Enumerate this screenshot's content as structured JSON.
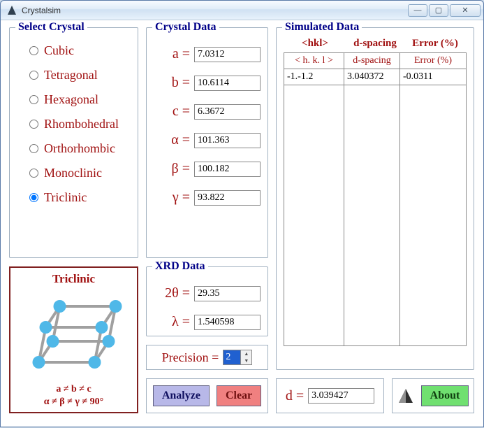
{
  "window": {
    "title": "Crystalsim"
  },
  "select_crystal": {
    "legend": "Select Crystal",
    "options": [
      "Cubic",
      "Tetragonal",
      "Hexagonal",
      "Rhombohedral",
      "Orthorhombic",
      "Monoclinic",
      "Triclinic"
    ],
    "selected": "Triclinic"
  },
  "crystal_card": {
    "name": "Triclinic",
    "line1": "a ≠ b ≠ c",
    "line2": "α ≠ β ≠ γ ≠ 90°"
  },
  "crystal_data": {
    "legend": "Crystal Data",
    "a_label": "a =",
    "a": "7.0312",
    "b_label": "b =",
    "b": "10.6114",
    "c_label": "c =",
    "c": "6.3672",
    "alpha_label": "α =",
    "alpha": "101.363",
    "beta_label": "β =",
    "beta": "100.182",
    "gamma_label": "γ =",
    "gamma": "93.822"
  },
  "xrd_data": {
    "legend": "XRD Data",
    "twotheta_label": "2θ =",
    "twotheta": "29.35",
    "lambda_label": "λ =",
    "lambda": "1.540598"
  },
  "precision": {
    "label": "Precision =",
    "value": "2"
  },
  "buttons": {
    "analyze": "Analyze",
    "clear": "Clear",
    "about": "About"
  },
  "sim": {
    "legend": "Simulated Data",
    "header_hkl": "<hkl>",
    "header_dspacing": "d-spacing",
    "header_error": "Error (%)",
    "col_hkl": "< h. k. l >",
    "col_dspacing": "d-spacing",
    "col_error": "Error (%)",
    "rows": [
      {
        "hkl": "-1.-1.2",
        "d": "3.040372",
        "err": "-0.0311"
      }
    ]
  },
  "result": {
    "d_label": "d =",
    "d": "3.039427"
  }
}
